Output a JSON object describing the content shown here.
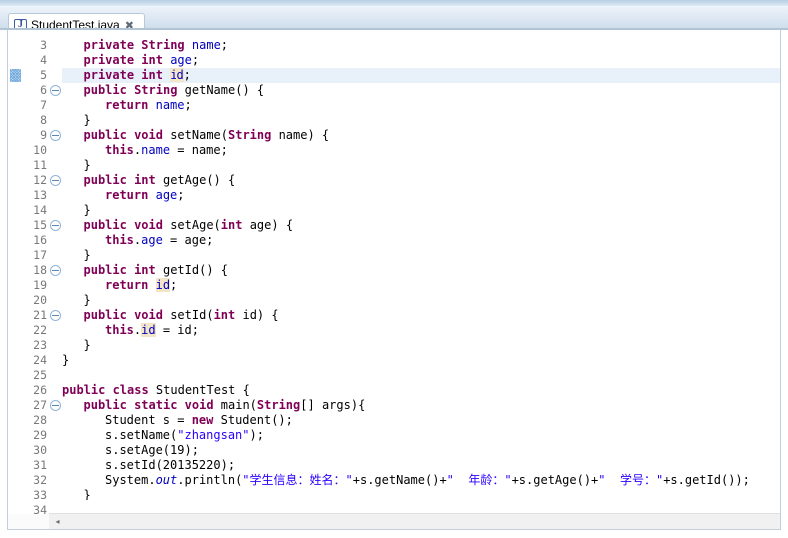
{
  "window": {
    "title": "StudentTest.java"
  },
  "tab": {
    "label": "StudentTest.java",
    "icon": "java-file-icon",
    "icon_letter": "J",
    "close_glyph": "✖",
    "active": true
  },
  "editor": {
    "current_line": 5,
    "first_line": 3,
    "last_line": 34,
    "fold_lines": [
      6,
      9,
      12,
      15,
      18,
      21,
      27
    ],
    "change_marker_line": 5,
    "colors": {
      "keyword": "#7f0055",
      "field": "#0000c0",
      "string": "#2a00ff",
      "text": "#000000",
      "line_number": "#787878",
      "current_line_bg": "#e8f0fa",
      "occurrence_bg": "#f3e6c8",
      "background": "#ffffff"
    },
    "lines": [
      {
        "n": 3,
        "indent": 1,
        "fold": false,
        "tokens": [
          {
            "t": "private ",
            "c": "kw"
          },
          {
            "t": "String",
            "c": "kw"
          },
          {
            "t": " "
          },
          {
            "t": "name",
            "c": "fld"
          },
          {
            "t": ";"
          }
        ]
      },
      {
        "n": 4,
        "indent": 1,
        "fold": false,
        "tokens": [
          {
            "t": "private int ",
            "c": "kw"
          },
          {
            "t": "age",
            "c": "fld"
          },
          {
            "t": ";"
          }
        ]
      },
      {
        "n": 5,
        "indent": 1,
        "fold": false,
        "tokens": [
          {
            "t": "private int ",
            "c": "kw"
          },
          {
            "t": "i",
            "c": "fld occ"
          },
          {
            "t": "",
            "c": "caret"
          },
          {
            "t": "d",
            "c": "fld occ"
          },
          {
            "t": ";"
          }
        ]
      },
      {
        "n": 6,
        "indent": 1,
        "fold": true,
        "tokens": [
          {
            "t": "public ",
            "c": "kw"
          },
          {
            "t": "String",
            "c": "kw"
          },
          {
            "t": " getName() {"
          }
        ]
      },
      {
        "n": 7,
        "indent": 2,
        "fold": false,
        "tokens": [
          {
            "t": "return",
            "c": "kw"
          },
          {
            "t": " "
          },
          {
            "t": "name",
            "c": "fld"
          },
          {
            "t": ";"
          }
        ]
      },
      {
        "n": 8,
        "indent": 1,
        "fold": false,
        "tokens": [
          {
            "t": "}"
          }
        ]
      },
      {
        "n": 9,
        "indent": 1,
        "fold": true,
        "tokens": [
          {
            "t": "public void ",
            "c": "kw"
          },
          {
            "t": "setName("
          },
          {
            "t": "String",
            "c": "kw"
          },
          {
            "t": " name) {"
          }
        ]
      },
      {
        "n": 10,
        "indent": 2,
        "fold": false,
        "tokens": [
          {
            "t": "this",
            "c": "kw"
          },
          {
            "t": "."
          },
          {
            "t": "name",
            "c": "fld"
          },
          {
            "t": " = name;"
          }
        ]
      },
      {
        "n": 11,
        "indent": 1,
        "fold": false,
        "tokens": [
          {
            "t": "}"
          }
        ]
      },
      {
        "n": 12,
        "indent": 1,
        "fold": true,
        "tokens": [
          {
            "t": "public int ",
            "c": "kw"
          },
          {
            "t": "getAge() {"
          }
        ]
      },
      {
        "n": 13,
        "indent": 2,
        "fold": false,
        "tokens": [
          {
            "t": "return",
            "c": "kw"
          },
          {
            "t": " "
          },
          {
            "t": "age",
            "c": "fld"
          },
          {
            "t": ";"
          }
        ]
      },
      {
        "n": 14,
        "indent": 1,
        "fold": false,
        "tokens": [
          {
            "t": "}"
          }
        ]
      },
      {
        "n": 15,
        "indent": 1,
        "fold": true,
        "tokens": [
          {
            "t": "public void ",
            "c": "kw"
          },
          {
            "t": "setAge("
          },
          {
            "t": "int",
            "c": "kw"
          },
          {
            "t": " age) {"
          }
        ]
      },
      {
        "n": 16,
        "indent": 2,
        "fold": false,
        "tokens": [
          {
            "t": "this",
            "c": "kw"
          },
          {
            "t": "."
          },
          {
            "t": "age",
            "c": "fld"
          },
          {
            "t": " = age;"
          }
        ]
      },
      {
        "n": 17,
        "indent": 1,
        "fold": false,
        "tokens": [
          {
            "t": "}"
          }
        ]
      },
      {
        "n": 18,
        "indent": 1,
        "fold": true,
        "tokens": [
          {
            "t": "public int ",
            "c": "kw"
          },
          {
            "t": "getId() {"
          }
        ]
      },
      {
        "n": 19,
        "indent": 2,
        "fold": false,
        "tokens": [
          {
            "t": "return",
            "c": "kw"
          },
          {
            "t": " "
          },
          {
            "t": "id",
            "c": "fld occ"
          },
          {
            "t": ";"
          }
        ]
      },
      {
        "n": 20,
        "indent": 1,
        "fold": false,
        "tokens": [
          {
            "t": "}"
          }
        ]
      },
      {
        "n": 21,
        "indent": 1,
        "fold": true,
        "tokens": [
          {
            "t": "public void ",
            "c": "kw"
          },
          {
            "t": "setId("
          },
          {
            "t": "int",
            "c": "kw"
          },
          {
            "t": " id) {"
          }
        ]
      },
      {
        "n": 22,
        "indent": 2,
        "fold": false,
        "tokens": [
          {
            "t": "this",
            "c": "kw"
          },
          {
            "t": "."
          },
          {
            "t": "id",
            "c": "fld occ"
          },
          {
            "t": " = id;"
          }
        ]
      },
      {
        "n": 23,
        "indent": 1,
        "fold": false,
        "tokens": [
          {
            "t": "}"
          }
        ]
      },
      {
        "n": 24,
        "indent": 0,
        "fold": false,
        "tokens": [
          {
            "t": "}"
          }
        ]
      },
      {
        "n": 25,
        "indent": 0,
        "fold": false,
        "tokens": []
      },
      {
        "n": 26,
        "indent": 0,
        "fold": false,
        "tokens": [
          {
            "t": "public class ",
            "c": "kw"
          },
          {
            "t": "StudentTest {"
          }
        ]
      },
      {
        "n": 27,
        "indent": 1,
        "fold": true,
        "tokens": [
          {
            "t": "public static void ",
            "c": "kw"
          },
          {
            "t": "main("
          },
          {
            "t": "String",
            "c": "kw"
          },
          {
            "t": "[] args){"
          }
        ]
      },
      {
        "n": 28,
        "indent": 2,
        "fold": false,
        "tokens": [
          {
            "t": "Student s = "
          },
          {
            "t": "new",
            "c": "kw"
          },
          {
            "t": " Student();"
          }
        ]
      },
      {
        "n": 29,
        "indent": 2,
        "fold": false,
        "tokens": [
          {
            "t": "s.setName("
          },
          {
            "t": "\"zhangsan\"",
            "c": "str"
          },
          {
            "t": ");"
          }
        ]
      },
      {
        "n": 30,
        "indent": 2,
        "fold": false,
        "tokens": [
          {
            "t": "s.setAge(19);"
          }
        ]
      },
      {
        "n": 31,
        "indent": 2,
        "fold": false,
        "tokens": [
          {
            "t": "s.setId(20135220);"
          }
        ]
      },
      {
        "n": 32,
        "indent": 2,
        "fold": false,
        "tokens": [
          {
            "t": "System."
          },
          {
            "t": "out",
            "c": "fldsi"
          },
          {
            "t": ".println("
          },
          {
            "t": "\"学生信息：姓名：\"",
            "c": "str"
          },
          {
            "t": "+s.getName()+"
          },
          {
            "t": "\"  年龄：\"",
            "c": "str"
          },
          {
            "t": "+s.getAge()+"
          },
          {
            "t": "\"  学号：\"",
            "c": "str"
          },
          {
            "t": "+s.getId());"
          }
        ]
      },
      {
        "n": 33,
        "indent": 1,
        "fold": false,
        "tokens": [
          {
            "t": "}"
          }
        ]
      },
      {
        "n": 34,
        "indent": 0,
        "fold": false,
        "tokens": []
      }
    ]
  },
  "scrollbar": {
    "horizontal_left_arrow": "◂"
  }
}
